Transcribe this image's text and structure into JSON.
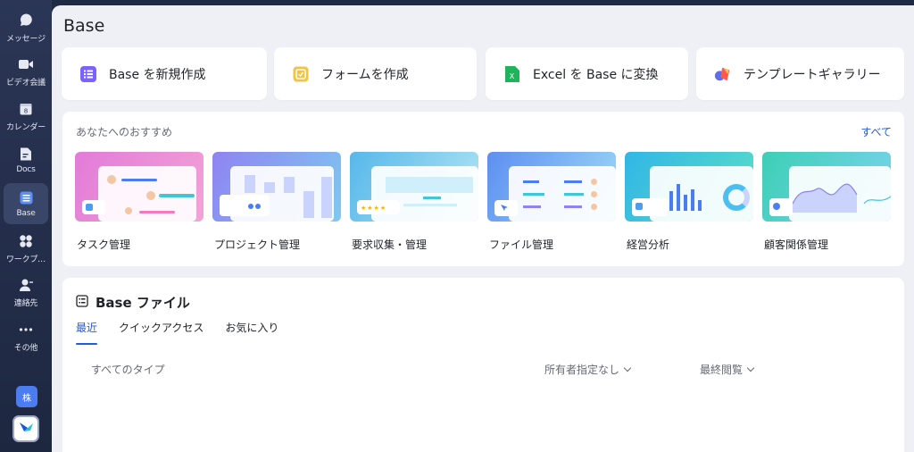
{
  "sidebar": {
    "items": [
      {
        "label": "メッセージ",
        "icon": "chat-icon"
      },
      {
        "label": "ビデオ会議",
        "icon": "video-icon"
      },
      {
        "label": "カレンダー",
        "icon": "calendar-icon",
        "day": "8"
      },
      {
        "label": "Docs",
        "icon": "docs-icon"
      },
      {
        "label": "Base",
        "icon": "base-icon"
      },
      {
        "label": "ワークプ…",
        "icon": "workplace-icon"
      },
      {
        "label": "連絡先",
        "icon": "contacts-icon"
      },
      {
        "label": "その他",
        "icon": "more-icon"
      }
    ],
    "active": "Base",
    "org_badge": "株"
  },
  "main": {
    "title": "Base",
    "quick_actions": [
      {
        "label": "Base を新規作成",
        "icon": "base-create-icon",
        "color": "#7b61ff"
      },
      {
        "label": "フォームを作成",
        "icon": "form-icon",
        "color": "#f5c242"
      },
      {
        "label": "Excel を Base に変換",
        "icon": "excel-icon",
        "color": "#1fb35b"
      },
      {
        "label": "テンプレートギャラリー",
        "icon": "template-gallery-icon",
        "color": "#ff5a4e"
      }
    ],
    "recommend": {
      "title": "あなたへのおすすめ",
      "all_link": "すべて",
      "templates": [
        {
          "name": "タスク管理",
          "color": "#d86fe0"
        },
        {
          "name": "プロジェクト管理",
          "color": "#8f83f2"
        },
        {
          "name": "要求収集・管理",
          "color": "#5bc3e9"
        },
        {
          "name": "ファイル管理",
          "color": "#5d8ef2"
        },
        {
          "name": "経営分析",
          "color": "#3fb8e8"
        },
        {
          "name": "顧客関係管理",
          "color": "#3ccfb5"
        }
      ]
    },
    "files": {
      "title": "Base ファイル",
      "tabs": [
        "最近",
        "クイックアクセス",
        "お気に入り"
      ],
      "active_tab": "最近",
      "filters": {
        "type": "すべてのタイプ",
        "owner": "所有者指定なし",
        "sort": "最終閲覧"
      }
    }
  }
}
